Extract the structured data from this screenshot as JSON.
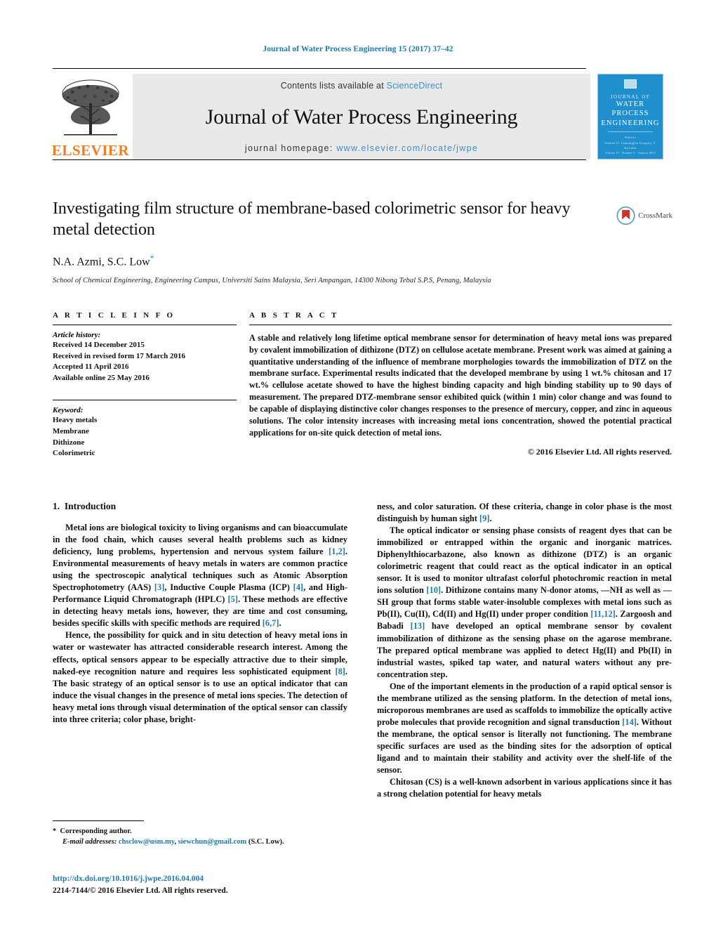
{
  "running_head": "Journal of Water Process Engineering 15 (2017) 37–42",
  "masthead": {
    "contents_prefix": "Contents lists available at ",
    "sciencedirect": "ScienceDirect",
    "journal_title": "Journal of Water Process Engineering",
    "homepage_prefix": "journal homepage: ",
    "homepage_url": "www.elsevier.com/locate/jwpe",
    "publisher": "ELSEVIER",
    "link_color": "#3b8fc4",
    "publisher_color": "#f57c20",
    "cover": {
      "line1": "JOURNAL OF",
      "line2": "WATER PROCESS",
      "line3": "ENGINEERING",
      "small1": "Editors",
      "small2": "Andrea G. Capodaglio   Gregory V. Korshin",
      "footer": "Volume 15 · Number 1 · January 2017",
      "bg_color": "#1f8fce"
    }
  },
  "article": {
    "title": "Investigating film structure of membrane-based colorimetric sensor for heavy metal detection",
    "authors": "N.A. Azmi, S.C. Low",
    "corresponding_marker": "*",
    "affiliation": "School of Chemical Engineering, Engineering Campus, Universiti Sains Malaysia, Seri Ampangan, 14300 Nibong Tebal S.P.S, Penang, Malaysia",
    "crossmark_label": "CrossMark"
  },
  "article_info": {
    "heading": "A R T I C L E   I N F O",
    "history_label": "Article history:",
    "history": [
      "Received 14 December 2015",
      "Received in revised form 17 March 2016",
      "Accepted 11 April 2016",
      "Available online 25 May 2016"
    ],
    "keyword_label": "Keyword:",
    "keywords": [
      "Heavy metals",
      "Membrane",
      "Dithizone",
      "Colorimetric"
    ]
  },
  "abstract": {
    "heading": "A B S T R A C T",
    "text": "A stable and relatively long lifetime optical membrane sensor for determination of heavy metal ions was prepared by covalent immobilization of dithizone (DTZ) on cellulose acetate membrane. Present work was aimed at gaining a quantitative understanding of the influence of membrane morphologies towards the immobilization of DTZ on the membrane surface. Experimental results indicated that the developed membrane by using 1 wt.% chitosan and 17 wt.% cellulose acetate showed to have the highest binding capacity and high binding stability up to 90 days of measurement. The prepared DTZ-membrane sensor exhibited quick (within 1 min) color change and was found to be capable of displaying distinctive color changes responses to the presence of mercury, copper, and zinc in aqueous solutions. The color intensity increases with increasing metal ions concentration, showed the potential practical applications for on-site quick detection of metal ions.",
    "copyright": "© 2016 Elsevier Ltd. All rights reserved."
  },
  "introduction": {
    "section_number": "1.",
    "section_title": "Introduction",
    "left_paragraphs": [
      "Metal ions are biological toxicity to living organisms and can bioaccumulate in the food chain, which causes several health problems such as kidney deficiency, lung problems, hypertension and nervous system failure [1,2]. Environmental measurements of heavy metals in waters are common practice using the spectroscopic analytical techniques such as Atomic Absorption Spectrophotometry (AAS) [3], Inductive Couple Plasma (ICP) [4], and High-Performance Liquid Chromatograph (HPLC) [5]. These methods are effective in detecting heavy metals ions, however, they are time and cost consuming, besides specific skills with specific methods are required [6,7].",
      "Hence, the possibility for quick and in situ detection of heavy metal ions in water or wastewater has attracted considerable research interest. Among the effects, optical sensors appear to be especially attractive due to their simple, naked-eye recognition nature and requires less sophisticated equipment [8]. The basic strategy of an optical sensor is to use an optical indicator that can induce the visual changes in the presence of metal ions species. The detection of heavy metal ions through visual determination of the optical sensor can classify into three criteria; color phase, bright-"
    ],
    "right_paragraphs": [
      "ness, and color saturation. Of these criteria, change in color phase is the most distinguish by human sight [9].",
      "The optical indicator or sensing phase consists of reagent dyes that can be immobilized or entrapped within the organic and inorganic matrices. Diphenylthiocarbazone, also known as dithizone (DTZ) is an organic colorimetric reagent that could react as the optical indicator in an optical sensor. It is used to monitor ultrafast colorful photochromic reaction in metal ions solution [10]. Dithizone contains many N-donor atoms, —NH as well as —SH group that forms stable water-insoluble complexes with metal ions such as Pb(II), Cu(II), Cd(II) and Hg(II) under proper condition [11,12]. Zargoosh and Babadi [13] have developed an optical membrane sensor by covalent immobilization of dithizone as the sensing phase on the agarose membrane. The prepared optical membrane was applied to detect Hg(II) and Pb(II) in industrial wastes, spiked tap water, and natural waters without any pre-concentration step.",
      "One of the important elements in the production of a rapid optical sensor is the membrane utilized as the sensing platform. In the detection of metal ions, microporous membranes are used as scaffolds to immobilize the optically active probe molecules that provide recognition and signal transduction [14]. Without the membrane, the optical sensor is literally not functioning. The membrane specific surfaces are used as the binding sites for the adsorption of optical ligand and to maintain their stability and activity over the shelf-life of the sensor.",
      "Chitosan (CS) is a well-known adsorbent in various applications since it has a strong chelation potential for heavy metals"
    ]
  },
  "footnote": {
    "corresponding_marker": "*",
    "corresponding_text": "Corresponding author.",
    "email_label": "E-mail addresses:",
    "email1": "chsclow@usm.my",
    "email_sep": ", ",
    "email2": "siewchun@gmail.com",
    "email_owner": " (S.C. Low).",
    "doi": "http://dx.doi.org/10.1016/j.jwpe.2016.04.004",
    "issn_line": "2214-7144/© 2016 Elsevier Ltd. All rights reserved."
  }
}
